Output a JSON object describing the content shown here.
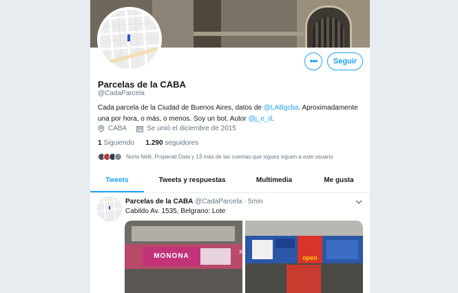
{
  "profile": {
    "name": "Parcelas de la CABA",
    "handle": "@CadaParcela",
    "follow_label": "Seguir",
    "more_label": "•••",
    "bio_text_1": "Cada parcela de la Ciudad de Buenos Aires, datos de ",
    "bio_link_1": "@LABgcba",
    "bio_text_2": ". Aproximadamente una por hora, o más, o menos. Soy un bot. Autor ",
    "bio_link_2": "@j_e_d",
    "bio_text_3": ".",
    "location": "CABA",
    "joined": "Se unió el diciembre de 2015",
    "following_count": "1",
    "following_label": "Siguiendo",
    "followers_count": "1.290",
    "followers_label": "seguidores",
    "followed_by": "Nuria Nelli, Properati Data y 13 más de las cuentas que sigues siguen a este usuario"
  },
  "tabs": [
    {
      "label": "Tweets",
      "active": true
    },
    {
      "label": "Tweets y respuestas",
      "active": false
    },
    {
      "label": "Multimedia",
      "active": false
    },
    {
      "label": "Me gusta",
      "active": false
    }
  ],
  "tweet": {
    "author_name": "Parcelas de la CABA",
    "author_handle": "@CadaParcela",
    "separator": "·",
    "time": "5min",
    "text": "Cabildo Av. 1535, Belgrano: Lote",
    "photo1_sign": "MONONA",
    "photo2_sign": "open"
  },
  "icons": {
    "location": "map-pin-icon",
    "joined": "calendar-icon",
    "caret": "chevron-down-icon"
  },
  "colors": {
    "accent": "#1da1f2",
    "secondary_text": "#657786",
    "page_bg": "#e6ecf0"
  }
}
